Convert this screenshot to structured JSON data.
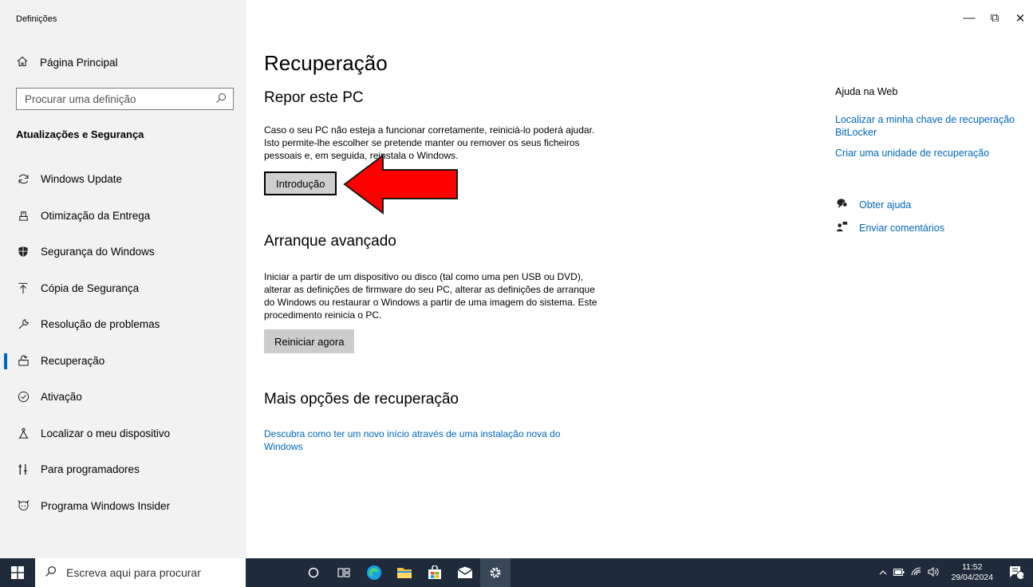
{
  "window": {
    "title": "Definições",
    "minimize": "—",
    "maximize": "⧉",
    "close": "✕"
  },
  "sidebar": {
    "home": "Página Principal",
    "search_placeholder": "Procurar uma definição",
    "section": "Atualizações e Segurança",
    "items": [
      {
        "label": "Windows Update",
        "icon": "refresh-icon"
      },
      {
        "label": "Otimização da Entrega",
        "icon": "delivery-icon"
      },
      {
        "label": "Segurança do Windows",
        "icon": "shield-icon"
      },
      {
        "label": "Cópia de Segurança",
        "icon": "backup-icon"
      },
      {
        "label": "Resolução de problemas",
        "icon": "wrench-icon"
      },
      {
        "label": "Recuperação",
        "icon": "recovery-icon",
        "active": true
      },
      {
        "label": "Ativação",
        "icon": "check-circle-icon"
      },
      {
        "label": "Localizar o meu dispositivo",
        "icon": "find-device-icon"
      },
      {
        "label": "Para programadores",
        "icon": "developer-icon"
      },
      {
        "label": "Programa Windows Insider",
        "icon": "insider-icon"
      }
    ]
  },
  "main": {
    "title": "Recuperação",
    "reset": {
      "heading": "Repor este PC",
      "text": "Caso o seu PC não esteja a funcionar corretamente, reiniciá-lo poderá ajudar. Isto permite-lhe escolher se pretende manter ou remover os seus ficheiros pessoais e, em seguida, reinstala o Windows.",
      "button": "Introdução"
    },
    "advanced": {
      "heading": "Arranque avançado",
      "text": "Iniciar a partir de um dispositivo ou disco (tal como uma pen USB ou DVD), alterar as definições de firmware do seu PC, alterar as definições de arranque do Windows ou restaurar o Windows a partir de uma imagem do sistema. Este procedimento reinicia o PC.",
      "button": "Reiniciar agora"
    },
    "more": {
      "heading": "Mais opções de recuperação",
      "link": "Descubra como ter um novo início através de uma instalação nova do Windows"
    }
  },
  "right": {
    "heading": "Ajuda na Web",
    "link1": "Localizar a minha chave de recuperação BitLocker",
    "link2": "Criar uma unidade de recuperação",
    "help": "Obter ajuda",
    "feedback": "Enviar comentários"
  },
  "taskbar": {
    "search_placeholder": "Escreva aqui para procurar",
    "time": "11:52",
    "date": "29/04/2024",
    "notifications": "1"
  },
  "colors": {
    "accent": "#0067c0",
    "arrow": "#ff0000",
    "taskbar": "#1f2b3a"
  }
}
